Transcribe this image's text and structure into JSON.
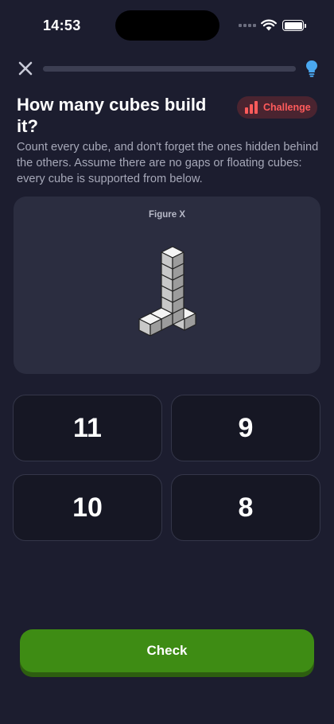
{
  "status_bar": {
    "time": "14:53"
  },
  "header": {
    "progress_fraction": 0.0
  },
  "question": {
    "title": "How many cubes build it?",
    "badge": "Challenge",
    "description": "Count every cube, and don't forget the ones hidden behind the others. Assume there are no gaps or floating cubes: every cube is supported from below."
  },
  "figure": {
    "label": "Figure X"
  },
  "answers": [
    "11",
    "9",
    "10",
    "8"
  ],
  "check_button": {
    "label": "Check"
  },
  "colors": {
    "background": "#1c1d2f",
    "card": "#2b2d40",
    "accent_green": "#3e8c14",
    "badge_red": "#ff5b5b",
    "hint_blue": "#4aa8f0"
  },
  "icons": {
    "close": "close-icon",
    "hint": "lightbulb-icon",
    "challenge": "bar-chart-icon",
    "wifi": "wifi-icon",
    "battery": "battery-icon",
    "signal": "signal-icon"
  }
}
